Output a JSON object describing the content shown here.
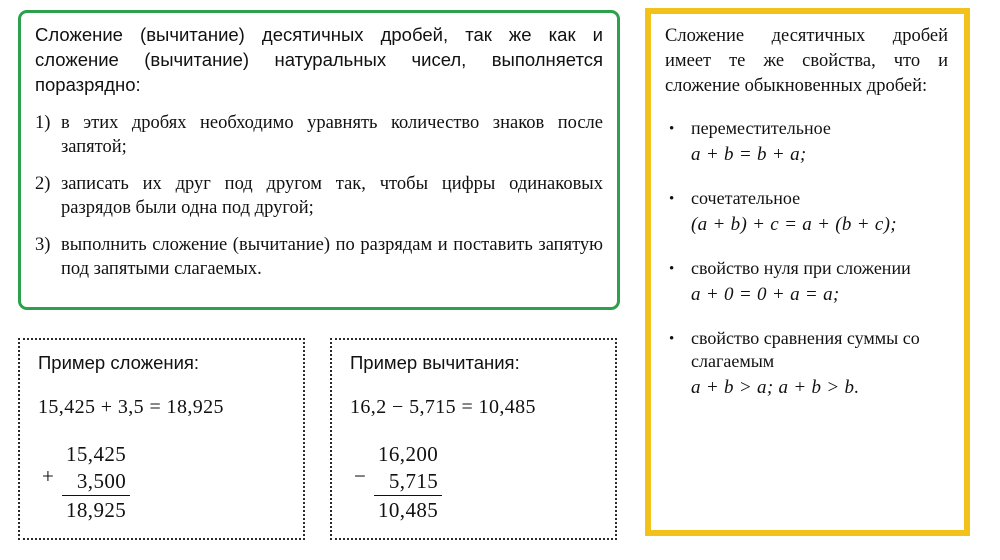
{
  "rule_box": {
    "intro": "Сложение (вычитание) десятичных дробей, так же как и сложение (вычитание) натуральных чисел, выполняется поразрядно:",
    "items": [
      {
        "marker": "1)",
        "text": "в этих дробях необходимо уравнять количество знаков после запятой;"
      },
      {
        "marker": "2)",
        "text": "записать их друг под другом так, чтобы цифры одинаковых разрядов были одна под другой;"
      },
      {
        "marker": "3)",
        "text": "выполнить сложение (вычитание) по разрядам и поставить запятую под запятыми слагаемых."
      }
    ],
    "border_color": "#2ba14e"
  },
  "examples": [
    {
      "title": "Пример сложения:",
      "equation": "15,425 + 3,5 = 18,925",
      "operator": "+",
      "operand_top": "15,425",
      "operand_bottom": "3,500",
      "result": "18,925"
    },
    {
      "title": "Пример вычитания:",
      "equation": "16,2 − 5,715 = 10,485",
      "operator": "−",
      "operand_top": "16,200",
      "operand_bottom": "5,715",
      "result": "10,485"
    }
  ],
  "properties_panel": {
    "header": "Сложение десятичных дробей имеет те же свойства, что и сложение обыкновенных дробей:",
    "bullet_glyph": "•",
    "border_color": "#f2c21a",
    "items": [
      {
        "label": "переместительное",
        "formula": "a + b = b + a;"
      },
      {
        "label": "сочетательное",
        "formula": "(a + b) + c = a + (b + c);"
      },
      {
        "label": "свойство нуля при сложении",
        "formula": "a + 0 = 0 + a = a;"
      },
      {
        "label": "свойство сравнения суммы со слагаемым",
        "formula": "a + b > a;  a + b > b."
      }
    ]
  }
}
